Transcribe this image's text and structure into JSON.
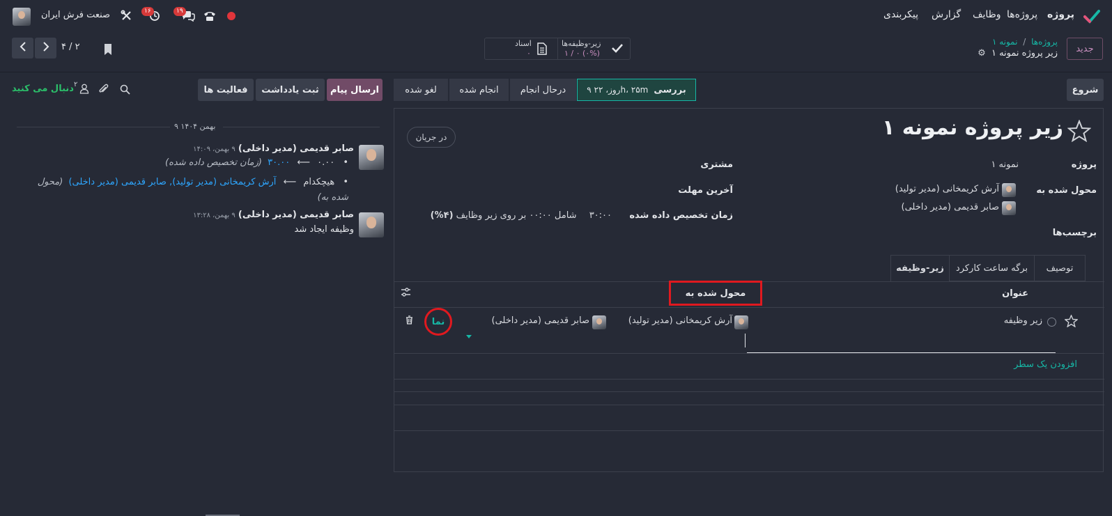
{
  "topnav": {
    "app_name": "پروژه",
    "items": [
      "پروژه‌ها",
      "وظایف",
      "گزارش",
      "پیکربندی"
    ],
    "company": "صنعت فرش ایران",
    "badge_chat": "۱۹",
    "badge_activity": "۱۶"
  },
  "control": {
    "new_button": "جدید",
    "breadcrumb_root": "پروژه‌ها",
    "breadcrumb_sep": "/",
    "breadcrumb_parent": "نمونه ۱",
    "record_title": "زیر پروژه نمونه ۱",
    "smart_subtasks_label": "زیر-وظیفه‌ها",
    "smart_subtasks_value": "۱ / ۰ (۰%)",
    "smart_docs_label": "اسناد",
    "smart_docs_value": "۰",
    "pager": "۴ / ۲"
  },
  "actions": {
    "start_button": "شروع",
    "send_message": "ارسال پیام",
    "log_note": "ثبت یادداشت",
    "activities": "فعالیت ها",
    "follow": "دنبال می کنید",
    "followers_count": "۲"
  },
  "stages": [
    {
      "label": "بررسی",
      "extra": "۹ روز، ۲۲h، ۲۵m",
      "active": true
    },
    {
      "label": "درحال انجام",
      "active": false
    },
    {
      "label": "انجام شده",
      "active": false
    },
    {
      "label": "لغو شده",
      "active": false
    }
  ],
  "form": {
    "title": "زیر پروژه نمونه ۱",
    "state_badge": "در جریان",
    "project_label": "پروژه",
    "project_value": "نمونه ۱",
    "assigned_label": "محول شده به",
    "assignee_1": "آرش کریمخانی (مدیر تولید)",
    "assignee_2": "صابر قدیمی (مدیر داخلی)",
    "tags_label": "برچسب‌ها",
    "customer_label": "مشتری",
    "deadline_label": "آخرین مهلت",
    "allocated_label": "زمان تخصیص داده شده",
    "allocated_value": "۳۰:۰۰",
    "allocated_sub": "شامل ۰۰:۰۰ بر روی زیر وظایف",
    "allocated_pct": "(۴%)"
  },
  "tabs": [
    "توصیف",
    "برگه ساعت کارکرد",
    "زیر-وظیفه"
  ],
  "subtasks": {
    "col_title": "عنوان",
    "col_assigned": "محول شده به",
    "rows": [
      {
        "title": "زیر وظیفه",
        "assignee_1": "آرش کریمخانی (مدیر تولید)",
        "assignee_2": "صابر قدیمی (مدیر داخلی)",
        "link": "نما"
      }
    ],
    "add_line": "افزودن یک سطر"
  },
  "chatter": {
    "date_sep": "۹ بهمن ۱۴۰۴",
    "messages": [
      {
        "author": "صابر قدیمی (مدیر داخلی)",
        "time": "۹ بهمن، ۱۴:۰۹",
        "line1_old": "۰.۰۰",
        "line1_new": "۳۰.۰۰",
        "line1_field": "(زمان تخصیص داده شده)",
        "line2_old": "هیچکدام",
        "line2_new": "آرش کریمخانی (مدیر تولید), صابر قدیمی (مدیر داخلی)",
        "line2_field": "(محول شده به)"
      },
      {
        "author": "صابر قدیمی (مدیر داخلی)",
        "time": "۹ بهمن، ۱۳:۲۸",
        "body": "وظیفه ایجاد شد"
      }
    ]
  },
  "colors": {
    "accent_teal": "#16b8a6",
    "send_button": "#714b67",
    "highlight_red": "#e0191f",
    "link_blue": "#2ea7ff"
  }
}
